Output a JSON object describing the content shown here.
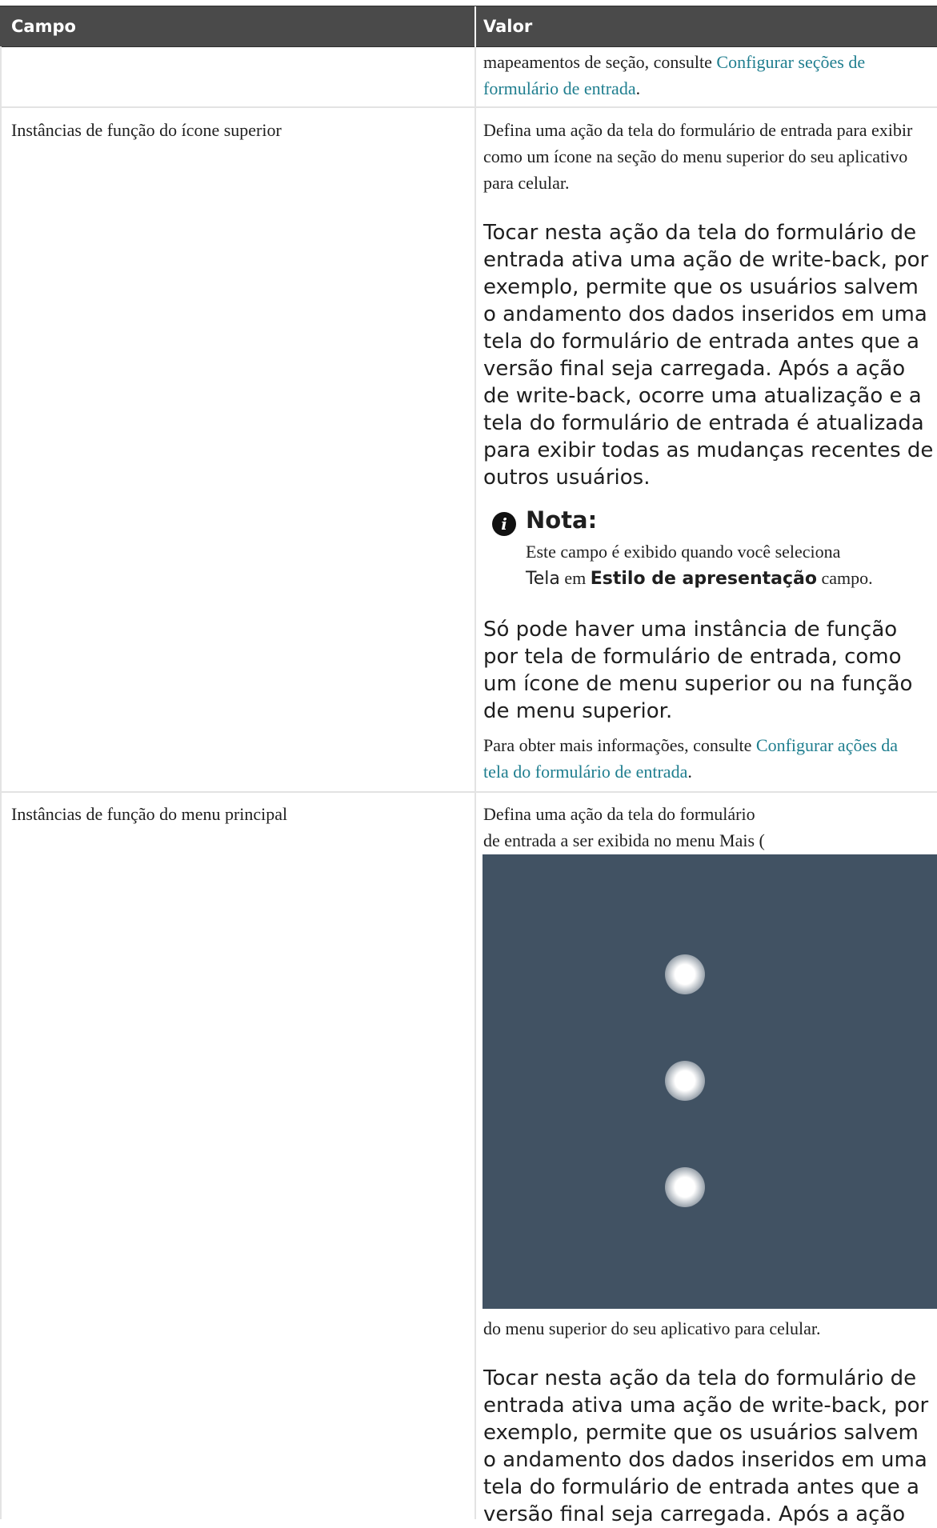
{
  "header": {
    "col_field": "Campo",
    "col_value": "Valor"
  },
  "row0": {
    "value_text": "mapeamentos de seção, consulte ",
    "value_link": "Configurar seções de formulário de entrada",
    "value_end": "."
  },
  "row1": {
    "field": "Instâncias de função do ícone superior",
    "p1": "Defina uma ação da tela do formulário de entrada para exibir como um ícone na seção do menu superior do seu aplicativo para celular.",
    "p2": "Tocar nesta ação da tela do formulário de entrada ativa uma ação de write-back, por exemplo, permite que os usuários salvem o andamento dos dados inseridos em uma tela do formulário de entrada antes que a versão final seja carregada. Após a ação de write-back, ocorre uma atualização e a tela do formulário de entrada é atualizada para exibir todas as mudanças recentes de outros usuários.",
    "note_title": "Nota:",
    "note_t1": "Este campo é exibido quando você seleciona",
    "note_kbd": "Tela",
    "note_t2": " em ",
    "note_bold": "Estilo de apresentação",
    "note_t3": " campo.",
    "p3": "Só pode haver uma instância de função por tela de formulário de entrada, como um ícone de menu superior ou na função de menu superior.",
    "p4_text": "Para obter mais informações, consulte ",
    "p4_link": "Configurar ações da tela do formulário de entrada",
    "p4_end": "."
  },
  "row2": {
    "field": "Instâncias de função do menu principal",
    "p1a": "Defina uma ação da tela do formulário",
    "p1b": "de entrada a ser exibida no menu Mais (",
    "image_icon": "more-vertical-icon",
    "p1c": "do menu superior do seu aplicativo para celular.",
    "p2": "Tocar nesta ação da tela do formulário de entrada ativa uma ação de write-back, por exemplo, permite que os usuários salvem o andamento dos dados inseridos em uma tela do formulário de entrada antes que a versão final seja carregada. Após a ação"
  },
  "colors": {
    "header_bg": "#4a4a4a",
    "link": "#1f7e8f",
    "image_bg": "#415263"
  }
}
